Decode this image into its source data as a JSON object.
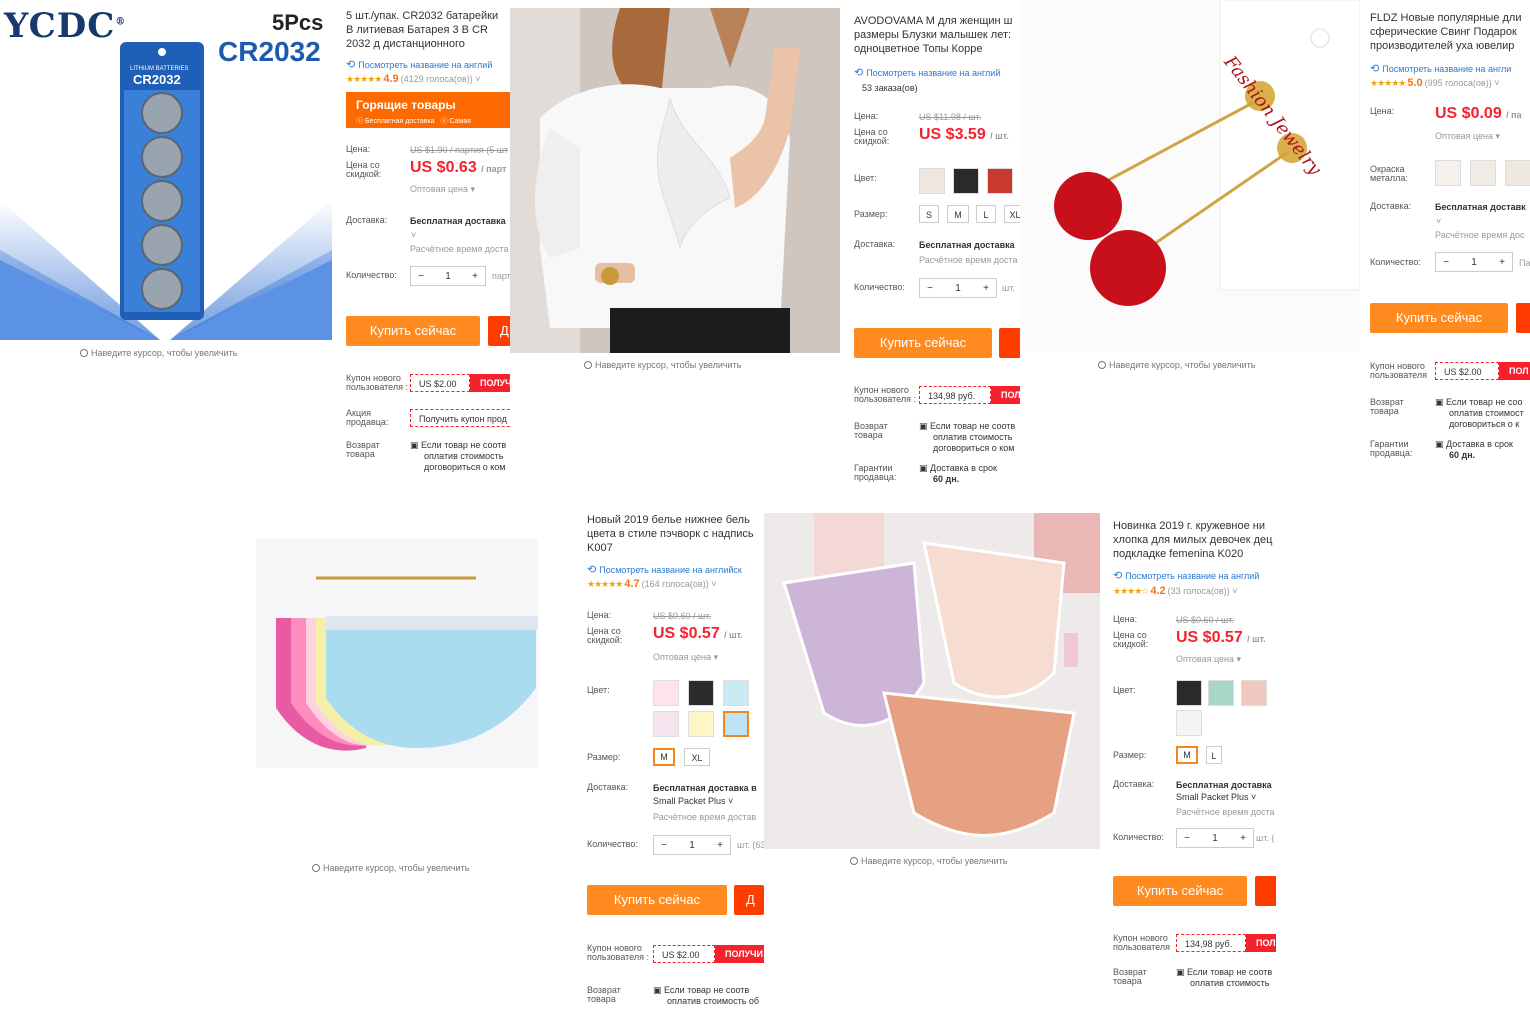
{
  "hint": "Наведите курсор, чтобы увеличить",
  "colors": {
    "accent": "#ff8b20",
    "price": "#f5222d",
    "link": "#2d78d2",
    "star": "#f0a30a"
  },
  "p1": {
    "brand": "YCDC",
    "reg": "®",
    "pack_count": "5Pcs",
    "model": "CR2032",
    "card_text": "LITHIUM BATTERIES",
    "card_model": "CR2032",
    "title": "5 шт./упак. CR2032 батарейки В литиевая Батарея 3 В CR 2032 д дистанционного",
    "translate": "Посмотреть название на англий",
    "rating": "4.9",
    "votes": "(4129 голоса(ов))",
    "hot_title": "Горящие товары",
    "hot_sub1": "Бесплатная доставка",
    "hot_sub2": "Самая",
    "price_label": "Цена:",
    "old_price": "US $1.90 / партия",
    "old_suffix": "(5 шт",
    "discount_label": "Цена со скидкой:",
    "price": "US $0.63",
    "unit": "/ парт",
    "wholesale": "Оптовая цена",
    "delivery_label": "Доставка:",
    "delivery": "Бесплатная доставка",
    "eta": "Расчётное время доста",
    "qty_label": "Количество:",
    "qty": "1",
    "qty_suffix": "парт",
    "buy": "Купить сейчас",
    "cart": "Д",
    "coupon_label": "Купон нового пользователя :",
    "coupon": "US $2.00",
    "coupon_btn": "ПОЛУЧ",
    "promo_label": "Акция продавца:",
    "promo": "Получить купон прод",
    "return_label": "Возврат товара",
    "return_lines": [
      "Если товар не соотв",
      "оплатив стоимость",
      "договориться о ком"
    ]
  },
  "p2": {
    "title": "AVODOVAMA M для женщин ш размеры Блузки малышек лет: одноцветное Топы Корре",
    "translate": "Посмотреть название на англий",
    "orders": "53 заказа(ов)",
    "price_label": "Цена:",
    "old_price": "US $11.98 / шт.",
    "discount_label": "Цена со скидкой:",
    "price": "US $3.59",
    "unit": "/ шт.",
    "color_label": "Цвет:",
    "size_label": "Размер:",
    "sizes": [
      "S",
      "M",
      "L",
      "XL"
    ],
    "delivery_label": "Доставка:",
    "delivery": "Бесплатная доставка",
    "eta": "Расчётное время доста",
    "qty_label": "Количество:",
    "qty": "1",
    "qty_suffix": "шт.",
    "buy": "Купить сейчас",
    "coupon_label": "Купон нового пользователя :",
    "coupon": "134,98 руб.",
    "coupon_btn": "ПОЛ",
    "return_label": "Возврат товара",
    "return_lines": [
      "Если товар не соотв",
      "оплатив стоимость",
      "договориться о ком"
    ],
    "guarantee_label": "Гарантии продавца:",
    "guarantee": "Доставка в срок",
    "guarantee_days": "60 дн."
  },
  "p3": {
    "card_text": "Fashion Jewelry",
    "title": "FLDZ Новые популярные дли сферические Свинг Подарок производителей уха ювелир",
    "translate": "Посмотреть название на англи",
    "rating": "5.0",
    "votes": "(995 голоса(ов))",
    "price_label": "Цена:",
    "price": "US $0.09",
    "unit": "/ па",
    "wholesale": "Оптовая цена",
    "metal_label": "Окраска металла:",
    "delivery_label": "Доставка:",
    "delivery": "Бесплатная доставк",
    "eta": "Расчётное время дос",
    "qty_label": "Количество:",
    "qty": "1",
    "qty_suffix": "Па",
    "buy": "Купить сейчас",
    "coupon_label": "Купон нового пользователя",
    "coupon": "US $2.00",
    "coupon_btn": "ПОЛ",
    "return_label": "Возврат товара",
    "return_lines": [
      "Если товар не соо",
      "оплатив стоимост",
      "договориться о к"
    ],
    "guarantee_label": "Гарантии продавца:",
    "guarantee": "Доставка в срок",
    "guarantee_days": "60 дн."
  },
  "p4": {
    "title": "Новый 2019 белье нижнее бель цвета в стиле пэчворк с надпись K007",
    "translate": "Посмотреть название на английск",
    "rating": "4.7",
    "votes": "(164 голоса(ов))",
    "price_label": "Цена:",
    "old_price": "US $0.60 / шт.",
    "discount_label": "Цена со скидкой:",
    "price": "US $0.57",
    "unit": "/ шт.",
    "wholesale": "Оптовая цена",
    "color_label": "Цвет:",
    "size_label": "Размер:",
    "sizes": [
      "M",
      "XL"
    ],
    "delivery_label": "Доставка:",
    "delivery": "Бесплатная доставка в",
    "delivery2": "Small Packet Plus",
    "eta": "Расчётное время достав",
    "qty_label": "Количество:",
    "qty": "1",
    "qty_suffix": "шт. (63",
    "buy": "Купить сейчас",
    "cart": "Д",
    "coupon_label": "Купон нового пользователя :",
    "coupon": "US $2.00",
    "coupon_btn": "ПОЛУЧИ",
    "return_label": "Возврат товара",
    "return_lines": [
      "Если товар не соотв",
      "оплатив стоимость об"
    ]
  },
  "p5": {
    "title": "Новинка 2019 г. кружевное ни хлопка для милых девочек дец подкладке femenina K020",
    "translate": "Посмотреть название на англий",
    "rating": "4.2",
    "votes": "(33 голоса(ов))",
    "price_label": "Цена:",
    "old_price": "US $0.60 / шт.",
    "discount_label": "Цена со скидкой:",
    "price": "US $0.57",
    "unit": "/ шт.",
    "wholesale": "Оптовая цена",
    "color_label": "Цвет:",
    "size_label": "Размер:",
    "sizes": [
      "M",
      "L"
    ],
    "delivery_label": "Доставка:",
    "delivery": "Бесплатная доставка",
    "delivery2": "Small Packet Plus",
    "eta": "Расчётное время доста",
    "qty_label": "Количество:",
    "qty": "1",
    "qty_suffix": "шт. (",
    "buy": "Купить сейчас",
    "coupon_label": "Купон нового пользователя",
    "coupon": "134,98 руб.",
    "coupon_btn": "ПОЛ",
    "return_label": "Возврат товара",
    "return_lines": [
      "Если товар не соотв",
      "оплатив стоимость"
    ]
  }
}
